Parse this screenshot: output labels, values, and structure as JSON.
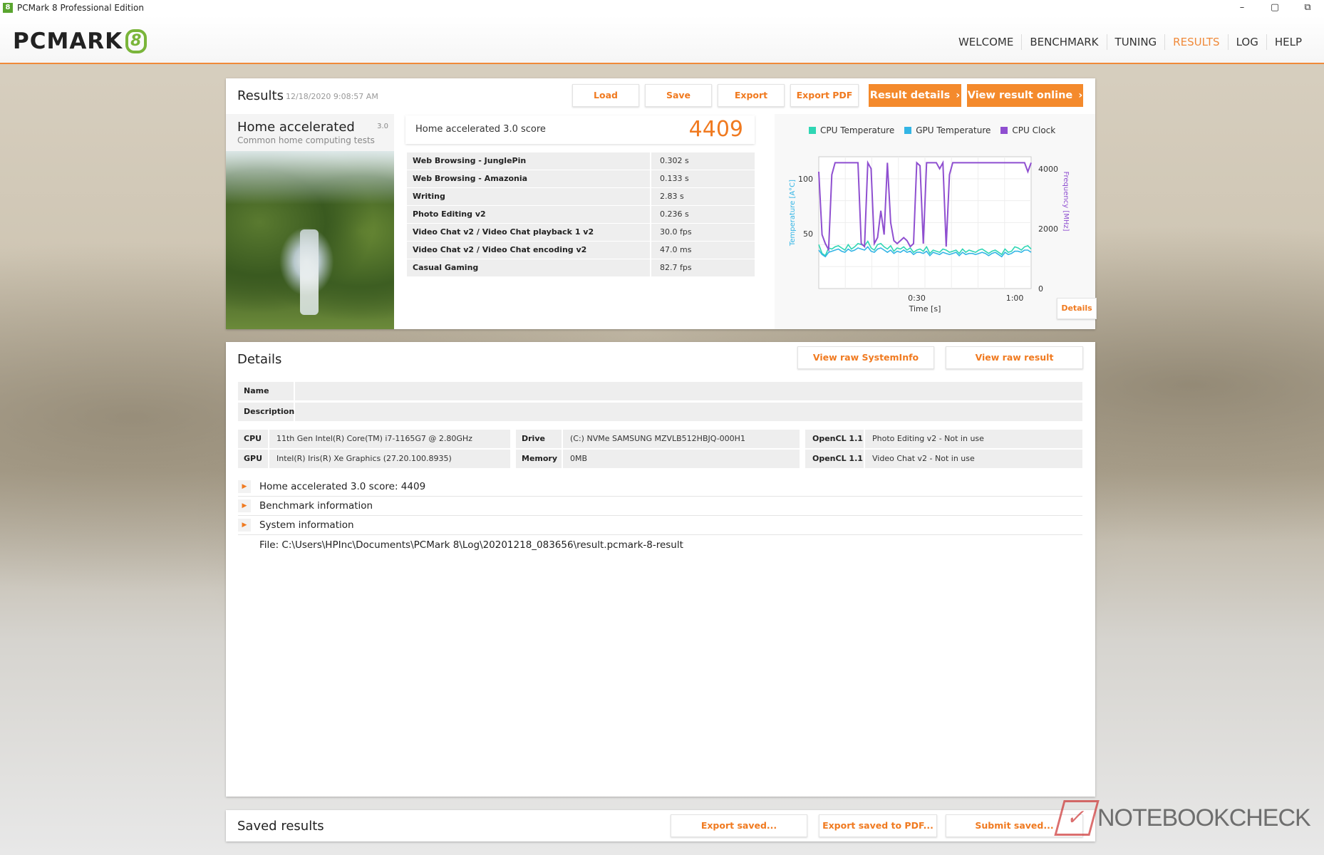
{
  "window": {
    "title": "PCMark 8 Professional Edition",
    "controls": [
      "–",
      "▢",
      "⧉"
    ]
  },
  "header": {
    "logo_text": "PCMARK",
    "logo_digit": "8",
    "nav": [
      {
        "label": "WELCOME",
        "active": false
      },
      {
        "label": "BENCHMARK",
        "active": false
      },
      {
        "label": "TUNING",
        "active": false
      },
      {
        "label": "RESULTS",
        "active": true
      },
      {
        "label": "LOG",
        "active": false
      },
      {
        "label": "HELP",
        "active": false
      }
    ]
  },
  "results": {
    "title": "Results",
    "date": "12/18/2020 9:08:57 AM",
    "buttons": {
      "load": "Load",
      "save": "Save",
      "export": "Export",
      "export_pdf": "Export PDF",
      "result_details": "Result details",
      "view_online": "View result online"
    },
    "benchmark": {
      "name": "Home accelerated",
      "version": "3.0",
      "subtitle": "Common home computing tests"
    },
    "score": {
      "label": "Home accelerated 3.0 score",
      "value": "4409"
    },
    "subscores": [
      {
        "name": "Web Browsing - JunglePin",
        "value": "0.302 s"
      },
      {
        "name": "Web Browsing - Amazonia",
        "value": "0.133 s"
      },
      {
        "name": "Writing",
        "value": "2.83 s"
      },
      {
        "name": "Photo Editing v2",
        "value": "0.236 s"
      },
      {
        "name": "Video Chat v2 / Video Chat playback 1 v2",
        "value": "30.0 fps"
      },
      {
        "name": "Video Chat v2 / Video Chat encoding v2",
        "value": "47.0 ms"
      },
      {
        "name": "Casual Gaming",
        "value": "82.7 fps"
      }
    ],
    "chart_details_button": "Details"
  },
  "chart_data": {
    "type": "line",
    "legend": [
      {
        "name": "CPU Temperature",
        "color": "#2fd6b4"
      },
      {
        "name": "GPU Temperature",
        "color": "#33b5e5"
      },
      {
        "name": "CPU Clock",
        "color": "#8f4fd0"
      }
    ],
    "xlabel": "Time [s]",
    "ylabel_left": "Temperature [A°C]",
    "ylabel_right": "Frequency [MHz]",
    "x_ticks": [
      "0:30",
      "1:00"
    ],
    "y_left_ticks": [
      "100",
      "50"
    ],
    "y_right_ticks": [
      "4000",
      "2000",
      "0"
    ],
    "x_range": [
      0,
      65
    ],
    "y_left_range": [
      0,
      120
    ],
    "y_right_range": [
      0,
      4400
    ],
    "series": [
      {
        "name": "CPU Temperature",
        "axis": "left",
        "x": [
          0,
          1,
          2,
          3,
          4,
          5,
          6,
          7,
          8,
          9,
          10,
          11,
          12,
          13,
          14,
          15,
          16,
          17,
          18,
          19,
          20,
          21,
          22,
          23,
          24,
          25,
          26,
          27,
          28,
          29,
          30,
          31,
          32,
          33,
          34,
          35,
          36,
          37,
          38,
          39,
          40,
          41,
          42,
          43,
          44,
          45,
          46,
          47,
          48,
          49,
          50,
          51,
          52,
          53,
          54,
          55,
          56,
          57,
          58,
          59,
          60,
          61,
          62,
          63,
          64,
          65
        ],
        "y": [
          40,
          32,
          30,
          37,
          36,
          38,
          39,
          37,
          35,
          40,
          36,
          38,
          41,
          40,
          39,
          43,
          37,
          35,
          40,
          41,
          38,
          36,
          39,
          34,
          37,
          36,
          38,
          35,
          37,
          33,
          35,
          36,
          34,
          38,
          32,
          35,
          34,
          33,
          36,
          35,
          33,
          34,
          35,
          32,
          36,
          33,
          35,
          34,
          33,
          35,
          36,
          34,
          32,
          34,
          35,
          33,
          31,
          36,
          33,
          34,
          38,
          37,
          35,
          38,
          39,
          36
        ]
      },
      {
        "name": "GPU Temperature",
        "axis": "left",
        "x": [
          0,
          1,
          2,
          3,
          4,
          5,
          6,
          7,
          8,
          9,
          10,
          11,
          12,
          13,
          14,
          15,
          16,
          17,
          18,
          19,
          20,
          21,
          22,
          23,
          24,
          25,
          26,
          27,
          28,
          29,
          30,
          31,
          32,
          33,
          34,
          35,
          36,
          37,
          38,
          39,
          40,
          41,
          42,
          43,
          44,
          45,
          46,
          47,
          48,
          49,
          50,
          51,
          52,
          53,
          54,
          55,
          56,
          57,
          58,
          59,
          60,
          61,
          62,
          63,
          64,
          65
        ],
        "y": [
          35,
          31,
          29,
          33,
          34,
          35,
          36,
          34,
          33,
          36,
          34,
          35,
          37,
          36,
          35,
          38,
          34,
          33,
          36,
          37,
          35,
          33,
          35,
          32,
          34,
          33,
          35,
          33,
          34,
          31,
          33,
          33,
          32,
          34,
          30,
          33,
          32,
          31,
          33,
          32,
          31,
          32,
          33,
          30,
          33,
          31,
          32,
          32,
          31,
          32,
          33,
          32,
          30,
          32,
          33,
          31,
          29,
          33,
          31,
          32,
          34,
          34,
          33,
          35,
          35,
          33
        ]
      },
      {
        "name": "CPU Clock",
        "axis": "right",
        "x": [
          0,
          1,
          2,
          3,
          4,
          5,
          6,
          7,
          8,
          9,
          10,
          11,
          12,
          13,
          14,
          15,
          16,
          17,
          18,
          19,
          20,
          21,
          22,
          23,
          24,
          25,
          26,
          27,
          28,
          29,
          30,
          31,
          32,
          33,
          34,
          35,
          36,
          37,
          38,
          39,
          40,
          41,
          42,
          43,
          44,
          45,
          46,
          47,
          48,
          49,
          50,
          51,
          52,
          53,
          54,
          55,
          56,
          57,
          58,
          59,
          60,
          61,
          62,
          63,
          64,
          65
        ],
        "y": [
          3900,
          1800,
          1500,
          1300,
          3800,
          4200,
          4200,
          4200,
          4200,
          4200,
          4200,
          4200,
          4200,
          1500,
          1400,
          4200,
          4000,
          1500,
          1700,
          2600,
          1800,
          4200,
          2200,
          1600,
          1500,
          1600,
          1700,
          1600,
          1400,
          1500,
          4200,
          4100,
          1500,
          4200,
          4200,
          4200,
          4200,
          4000,
          4200,
          1400,
          3800,
          4200,
          4200,
          4200,
          4200,
          4200,
          4200,
          4200,
          4200,
          4200,
          4200,
          4200,
          4200,
          4200,
          4200,
          4200,
          4200,
          4200,
          4200,
          4200,
          4200,
          4200,
          4200,
          4200,
          3900,
          4200
        ]
      }
    ]
  },
  "details": {
    "title": "Details",
    "buttons": {
      "raw_sysinfo": "View raw SystemInfo",
      "raw_result": "View raw result"
    },
    "name_label": "Name",
    "description_label": "Description",
    "sys": {
      "cpu_label": "CPU",
      "cpu_value": "11th Gen Intel(R) Core(TM) i7-1165G7 @ 2.80GHz",
      "gpu_label": "GPU",
      "gpu_value": "Intel(R) Iris(R) Xe Graphics (27.20.100.8935)",
      "drive_label": "Drive",
      "drive_value": "(C:) NVMe SAMSUNG MZVLB512HBJQ-000H1",
      "memory_label": "Memory",
      "memory_value": "0MB",
      "opencl1_label": "OpenCL 1.1",
      "opencl1_value": "Photo Editing v2 - Not in use",
      "opencl2_label": "OpenCL 1.1",
      "opencl2_value": "Video Chat v2 - Not in use"
    },
    "sections": [
      "Home accelerated 3.0 score: 4409",
      "Benchmark information",
      "System information"
    ],
    "file": "File: C:\\Users\\HPInc\\Documents\\PCMark 8\\Log\\20201218_083656\\result.pcmark-8-result"
  },
  "saved": {
    "title": "Saved results",
    "buttons": {
      "export_saved": "Export saved...",
      "export_saved_pdf": "Export saved to PDF...",
      "submit_saved": "Submit saved..."
    }
  },
  "watermark": {
    "text": "NOTEBOOKCHECK"
  }
}
